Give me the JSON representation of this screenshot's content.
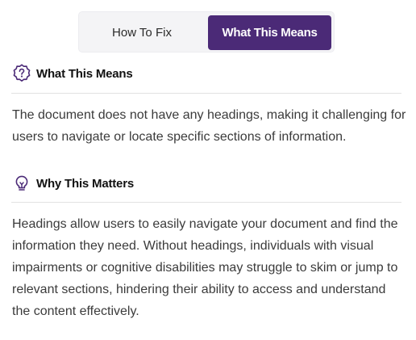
{
  "tabs": {
    "how_to_fix": "How To Fix",
    "what_this_means": "What This Means",
    "active": "what_this_means",
    "active_color": "#4b2a77"
  },
  "sections": [
    {
      "icon": "question-badge-icon",
      "title": "What This Means",
      "body": "The document does not have any headings, making it challenging for users to navigate or locate specific sections of information."
    },
    {
      "icon": "lightbulb-icon",
      "title": "Why This Matters",
      "body": "Headings allow users to easily navigate your document and find the information they need. Without headings, individuals with visual impairments or cognitive disabilities may struggle to skim or jump to relevant sections, hindering their ability to access and understand the content effectively."
    }
  ],
  "colors": {
    "icon": "#4b2a77",
    "body_text": "#3b3b3b"
  }
}
